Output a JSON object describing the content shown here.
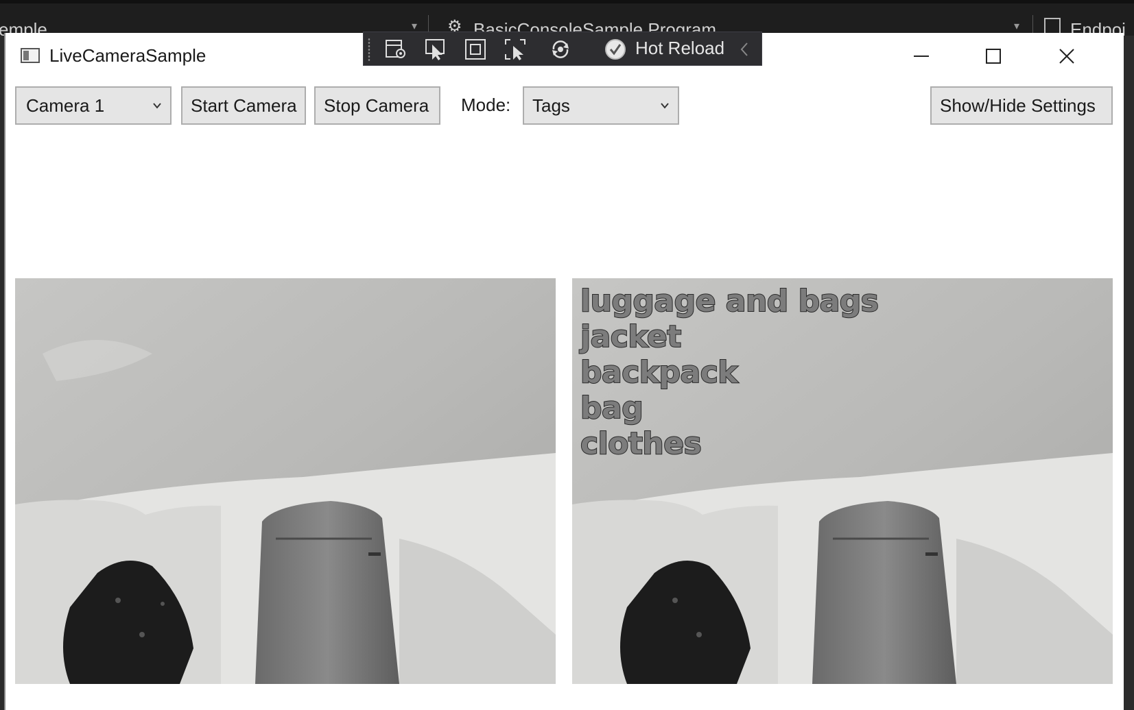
{
  "ide_background": {
    "left_text": "emple",
    "center_text": "BasicConsoleSample.Program",
    "right_text": "Endpoi"
  },
  "window": {
    "title": "LiveCameraSample",
    "controls": {
      "minimize_icon": "minimize-icon",
      "maximize_icon": "maximize-icon",
      "close_icon": "close-icon"
    }
  },
  "hot_reload_toolbar": {
    "icons": [
      "live-visual-tree-icon",
      "select-element-icon",
      "display-adorners-icon",
      "track-focus-icon",
      "hot-reload-refresh-icon",
      "hot-reload-check-icon"
    ],
    "label": "Hot Reload",
    "collapse_icon": "chevron-left-icon"
  },
  "controls": {
    "camera_select": {
      "value": "Camera 1"
    },
    "start_button": "Start Camera",
    "stop_button": "Stop Camera",
    "mode_label": "Mode:",
    "mode_select": {
      "value": "Tags"
    },
    "settings_button": "Show/Hide Settings"
  },
  "frames": {
    "live": {
      "name": "live-camera-frame"
    },
    "result": {
      "tags": [
        "luggage and bags",
        "jacket",
        "backpack",
        "bag",
        "clothes"
      ]
    }
  },
  "colors": {
    "window_bg": "#ffffff",
    "button_bg": "#e5e5e5",
    "toolbar_bg": "#2d2d30",
    "tag_text_stroke": "#2a2a2a"
  }
}
